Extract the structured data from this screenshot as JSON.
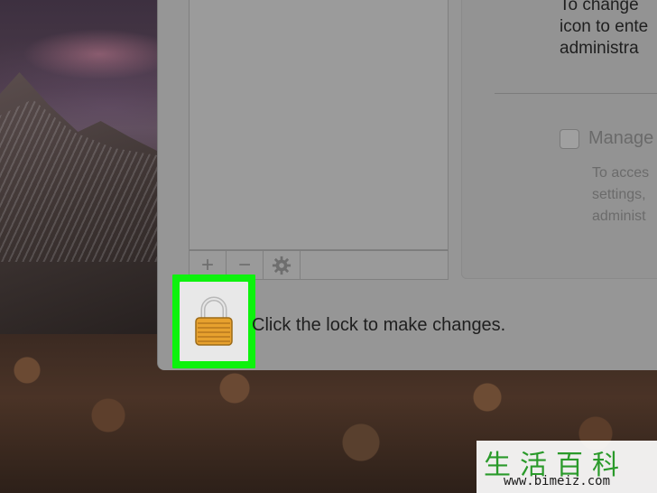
{
  "window": {
    "hint_text": "To change\nicon to ente\nadministra",
    "manage_label": "Manage",
    "manage_desc": "To acces\nsettings,\nadminist",
    "lock_caption": "Click the lock to make changes.",
    "list_toolbar": {
      "add": "+",
      "remove": "−",
      "settings_icon": "gear-icon"
    }
  },
  "watermark": {
    "chars": "生活百科",
    "url": "www.bimeiz.com"
  },
  "colors": {
    "highlight": "#0df20d",
    "window_bg": "#969696"
  }
}
